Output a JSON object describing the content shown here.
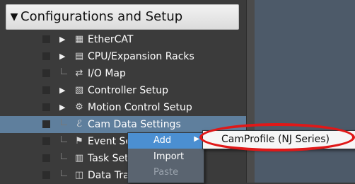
{
  "section": {
    "title": "Configurations and Setup",
    "icon": "triangle-down-icon"
  },
  "tree": [
    {
      "label": "EtherCAT",
      "icon": "ethercat-icon",
      "expandable": true
    },
    {
      "label": "CPU/Expansion Racks",
      "icon": "rack-icon",
      "expandable": true
    },
    {
      "label": "I/O Map",
      "icon": "io-map-icon",
      "expandable": false
    },
    {
      "label": "Controller Setup",
      "icon": "controller-icon",
      "expandable": true
    },
    {
      "label": "Motion Control Setup",
      "icon": "gear-icon",
      "expandable": true
    },
    {
      "label": "Cam Data Settings",
      "icon": "cam-icon",
      "expandable": false,
      "selected": true
    },
    {
      "label": "Event Setti",
      "icon": "flag-icon",
      "expandable": false
    },
    {
      "label": "Task Settir",
      "icon": "task-icon",
      "expandable": false
    },
    {
      "label": "Data Trace",
      "icon": "trace-icon",
      "expandable": false
    }
  ],
  "context_menu": {
    "items": [
      {
        "label": "Add",
        "has_submenu": true
      },
      {
        "label": "Import"
      },
      {
        "label": "Paste",
        "disabled": true
      }
    ]
  },
  "submenu": {
    "items": [
      {
        "label": "CamProfile (NJ Series)"
      }
    ]
  },
  "colors": {
    "selected_row": "#5f7f9d",
    "menu_highlight": "#4b8fd1",
    "annotation_ring": "#e01818"
  }
}
